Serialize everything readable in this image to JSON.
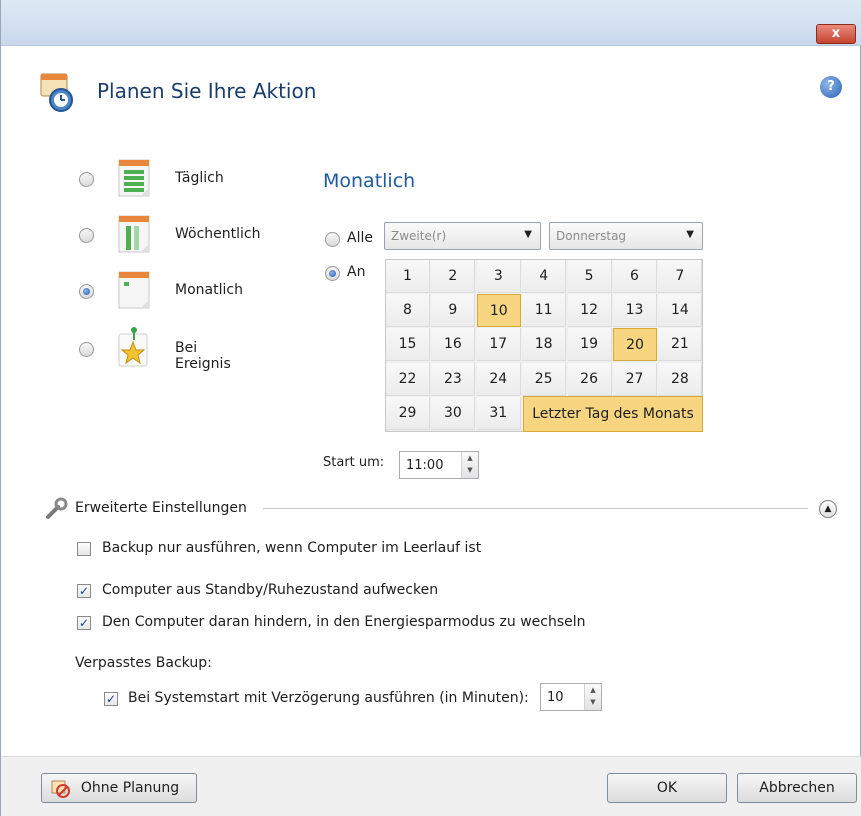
{
  "window": {
    "close_label": "x"
  },
  "header": {
    "title": "Planen Sie Ihre Aktion",
    "help_symbol": "?"
  },
  "frequency": {
    "options": [
      {
        "label": "Täglich",
        "selected": false,
        "icon": "daily-calendar-icon"
      },
      {
        "label": "Wöchentlich",
        "selected": false,
        "icon": "weekly-calendar-icon"
      },
      {
        "label": "Monatlich",
        "selected": true,
        "icon": "monthly-calendar-icon"
      },
      {
        "label": "Bei Ereignis",
        "selected": false,
        "icon": "event-star-icon"
      }
    ]
  },
  "monthly": {
    "title": "Monatlich",
    "alle_label": "Alle",
    "alle_selected": false,
    "week_value": "Zweite(r)",
    "weekday_value": "Donnerstag",
    "an_label": "An",
    "an_selected": true,
    "days": [
      "1",
      "2",
      "3",
      "4",
      "5",
      "6",
      "7",
      "8",
      "9",
      "10",
      "11",
      "12",
      "13",
      "14",
      "15",
      "16",
      "17",
      "18",
      "19",
      "20",
      "21",
      "22",
      "23",
      "24",
      "25",
      "26",
      "27",
      "28",
      "29",
      "30",
      "31"
    ],
    "selected_days": [
      "10",
      "20"
    ],
    "last_day_label": "Letzter Tag des Monats",
    "last_day_selected": true,
    "start_label": "Start um:",
    "start_time": "11:00"
  },
  "advanced": {
    "title": "Erweiterte Einstellungen",
    "checks": [
      {
        "label": "Backup nur ausführen, wenn Computer im Leerlauf ist",
        "checked": false
      },
      {
        "label": "Computer aus Standby/Ruhezustand aufwecken",
        "checked": true
      },
      {
        "label": "Den Computer daran hindern, in den Energiesparmodus zu wechseln",
        "checked": true
      }
    ],
    "missed_label": "Verpasstes Backup:",
    "delay_label": "Bei Systemstart mit Verzögerung ausführen (in Minuten):",
    "delay_checked": true,
    "delay_value": "10"
  },
  "footer": {
    "no_schedule_label": "Ohne Planung",
    "ok_label": "OK",
    "cancel_label": "Abbrechen"
  },
  "colors": {
    "accent": "#1f5aa4",
    "selected_day": "#f8d681"
  }
}
